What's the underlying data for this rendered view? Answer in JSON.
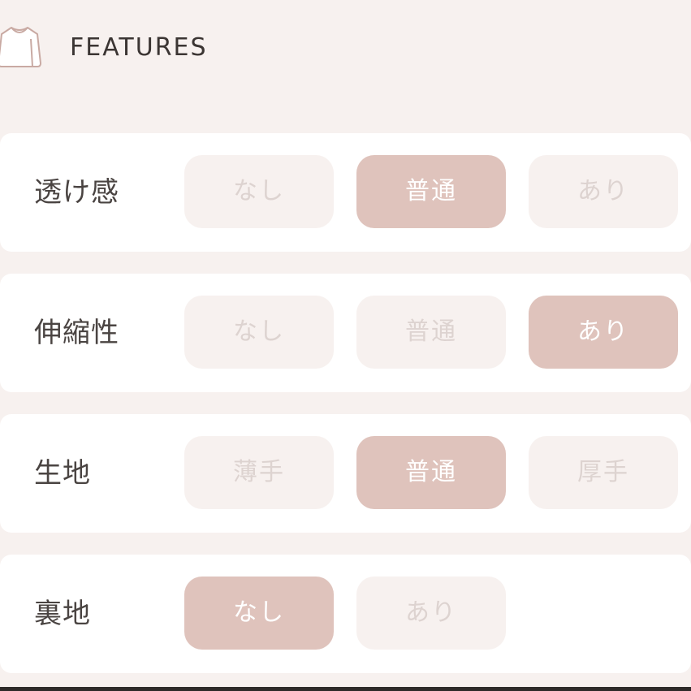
{
  "header": {
    "title": "FEATURES",
    "icon": "shirt-icon"
  },
  "colors": {
    "background": "#f7f1ef",
    "selected": "#dfc3bc",
    "unselected": "#f7f1ef",
    "unselected_text": "#ddd3d0"
  },
  "features": [
    {
      "label": "透け感",
      "options": [
        "なし",
        "普通",
        "あり"
      ],
      "selected": "普通"
    },
    {
      "label": "伸縮性",
      "options": [
        "なし",
        "普通",
        "あり"
      ],
      "selected": "あり"
    },
    {
      "label": "生地",
      "options": [
        "薄手",
        "普通",
        "厚手"
      ],
      "selected": "普通"
    },
    {
      "label": "裏地",
      "options": [
        "なし",
        "あり"
      ],
      "selected": "なし"
    }
  ]
}
